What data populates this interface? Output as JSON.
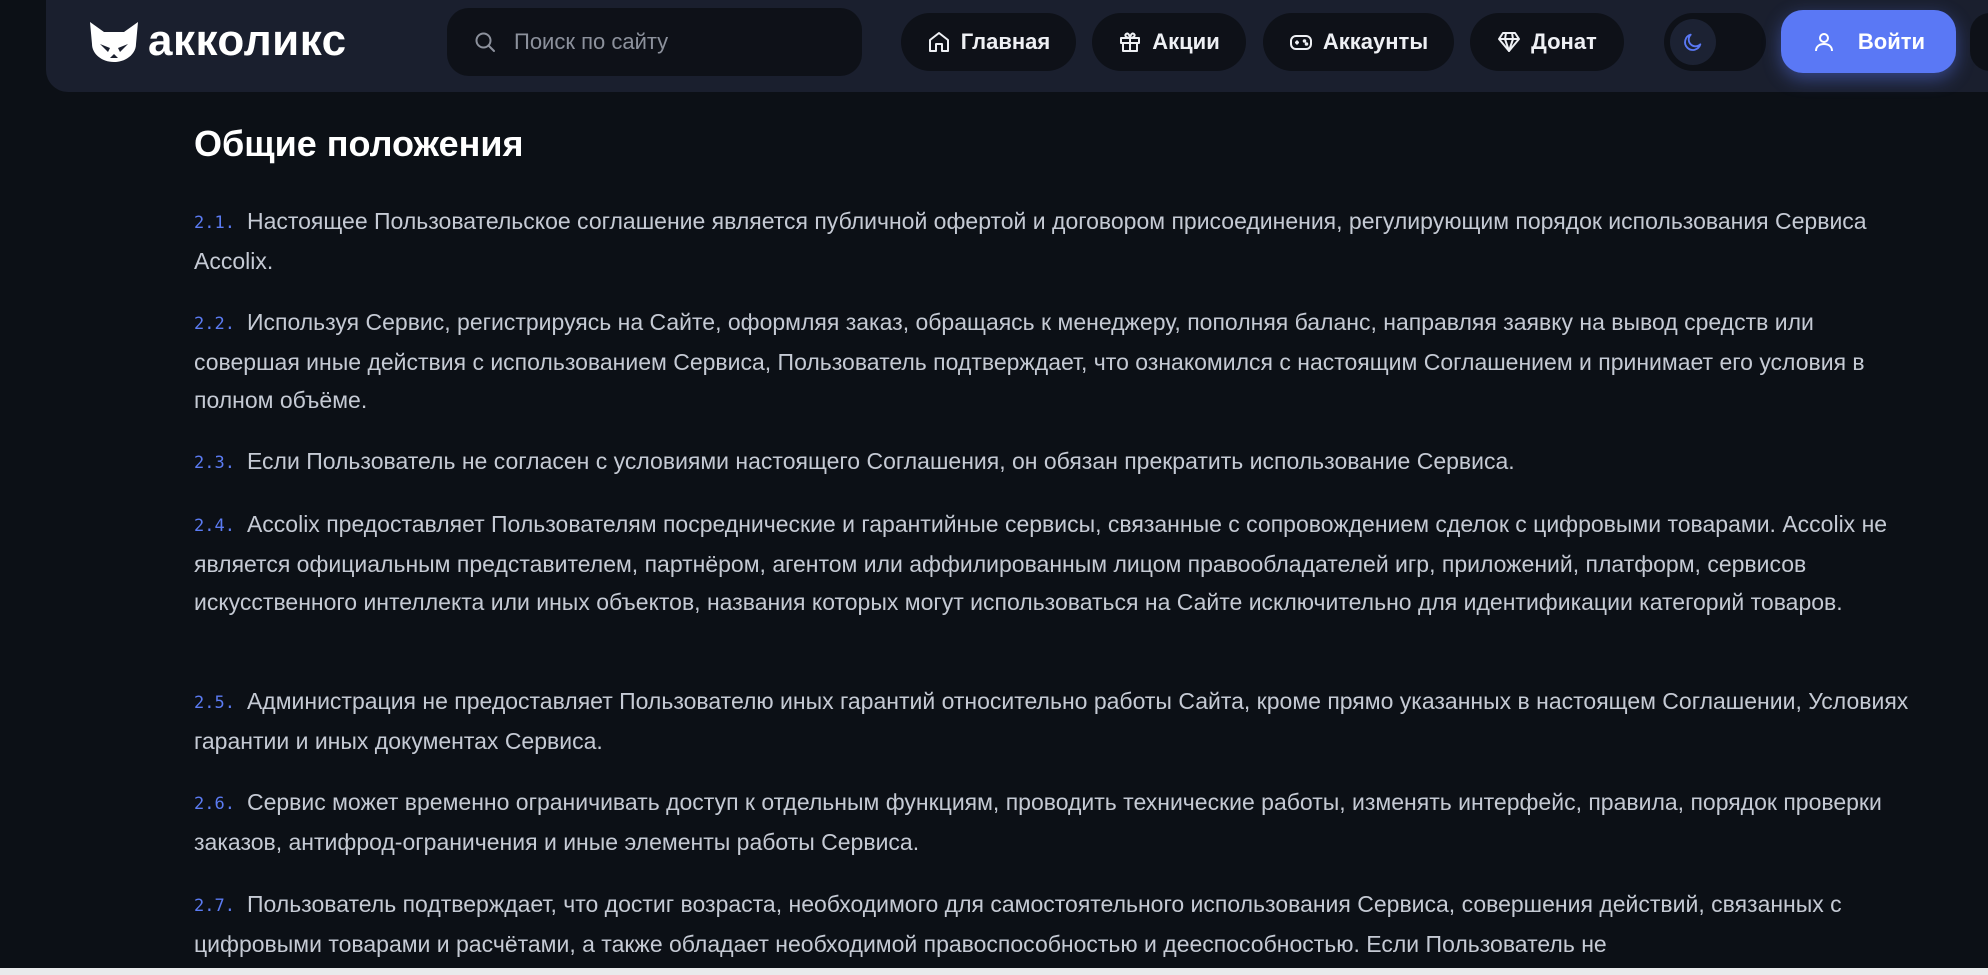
{
  "header": {
    "logo_text": "акколикс",
    "search": {
      "placeholder": "Поиск по сайту"
    },
    "nav": [
      {
        "label": "Главная",
        "icon": "home-icon"
      },
      {
        "label": "Акции",
        "icon": "gift-icon"
      },
      {
        "label": "Аккаунты",
        "icon": "gamepad-icon"
      },
      {
        "label": "Донат",
        "icon": "diamond-icon"
      }
    ],
    "theme_toggle_icon": "moon-icon",
    "login_label": "Войти",
    "accent_color": "#5a78f5"
  },
  "main": {
    "title": "Общие положения",
    "clauses": [
      {
        "num": "2.1.",
        "text": "Настоящее Пользовательское соглашение является публичной офертой и договором присоединения, регулирующим порядок использования Сервиса Accolix."
      },
      {
        "num": "2.2.",
        "text": "Используя Сервис, регистрируясь на Сайте, оформляя заказ, обращаясь к менеджеру, пополняя баланс, направляя заявку на вывод средств или совершая иные действия с использованием Сервиса, Пользователь подтверждает, что ознакомился с настоящим Соглашением и принимает его условия в полном объёме."
      },
      {
        "num": "2.3.",
        "text": "Если Пользователь не согласен с условиями настоящего Соглашения, он обязан прекратить использование Сервиса."
      },
      {
        "num": "2.4.",
        "text": "Accolix предоставляет Пользователям посреднические и гарантийные сервисы, связанные с сопровождением сделок с цифровыми товарами. Accolix не является официальным представителем, партнёром, агентом или аффилированным лицом правообладателей игр, приложений, платформ, сервисов искусственного интеллекта или иных объектов, названия которых могут использоваться на Сайте исключительно для идентификации категорий товаров."
      },
      {
        "num": "2.5.",
        "text": "Администрация не предоставляет Пользователю иных гарантий относительно работы Сайта, кроме прямо указанных в настоящем Соглашении, Условиях гарантии и иных документах Сервиса."
      },
      {
        "num": "2.6.",
        "text": "Сервис может временно ограничивать доступ к отдельным функциям, проводить технические работы, изменять интерфейс, правила, порядок проверки заказов, антифрод-ограничения и иные элементы работы Сервиса."
      },
      {
        "num": "2.7.",
        "text": "Пользователь подтверждает, что достиг возраста, необходимого для самостоятельного использования Сервиса, совершения действий, связанных с цифровыми товарами и расчётами, а также обладает необходимой правоспособностью и дееспособностью. Если Пользователь не"
      }
    ]
  }
}
